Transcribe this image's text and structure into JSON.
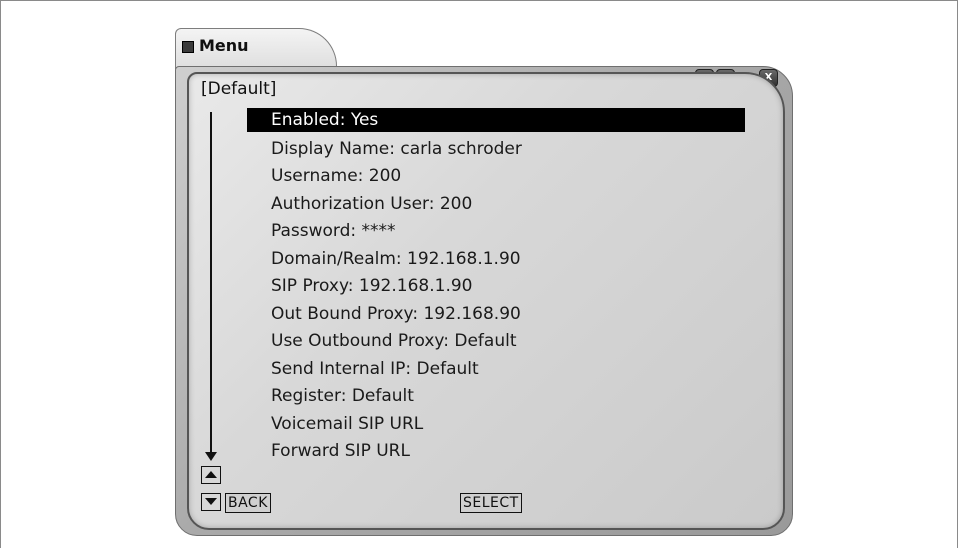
{
  "window": {
    "title": "Menu",
    "buttons": {
      "help": "?",
      "minimize": "_",
      "close": "X"
    }
  },
  "panel": {
    "group_label": "[Default]",
    "items": [
      {
        "label": "Enabled: Yes",
        "selected": true
      },
      {
        "label": "Display Name: carla schroder"
      },
      {
        "label": "Username: 200"
      },
      {
        "label": "Authorization User: 200"
      },
      {
        "label": "Password: ****"
      },
      {
        "label": "Domain/Realm: 192.168.1.90"
      },
      {
        "label": "SIP Proxy: 192.168.1.90"
      },
      {
        "label": "Out Bound Proxy: 192.168.90"
      },
      {
        "label": "Use Outbound Proxy: Default"
      },
      {
        "label": "Send Internal IP: Default"
      },
      {
        "label": "Register: Default"
      },
      {
        "label": "Voicemail SIP URL"
      },
      {
        "label": "Forward SIP URL"
      }
    ]
  },
  "softkeys": {
    "back": "BACK",
    "select": "SELECT"
  }
}
